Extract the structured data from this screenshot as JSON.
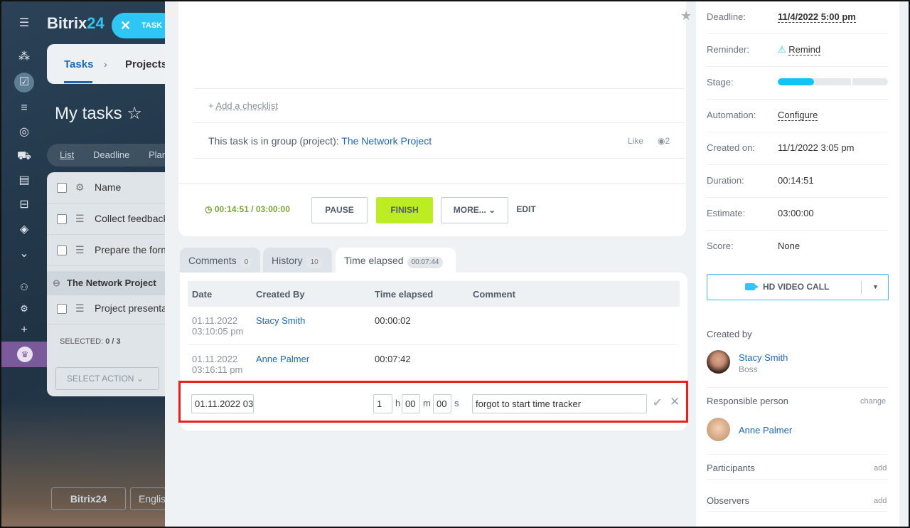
{
  "background": {
    "logo_main": "Bitrix",
    "logo_num": "24",
    "task_button": "TASK",
    "breadcrumb": {
      "tasks": "Tasks",
      "sep": "›",
      "projects": "Projects"
    },
    "page_title": "My tasks ☆",
    "view_tabs": [
      "List",
      "Deadline",
      "Plan"
    ],
    "list_header": "Name",
    "rows": [
      "Collect feedback",
      "Prepare the form"
    ],
    "group_name": "The Network Project",
    "group_row": "Project presenta",
    "selected": "SELECTED:",
    "selected_count": "0 / 3",
    "select_action": "SELECT ACTION",
    "footer_logo": "Bitrix24",
    "footer_lang": "English"
  },
  "task": {
    "add_checklist": "Add a checklist",
    "add_checklist_prefix": "+",
    "group_label": "This task is in group (project):",
    "group_link": "The Network Project",
    "like": "Like",
    "views": "2",
    "timer": "00:14:51 / 03:00:00",
    "buttons": {
      "pause": "PAUSE",
      "finish": "FINISH",
      "more": "MORE...",
      "edit": "EDIT"
    }
  },
  "tabs": [
    {
      "label": "Comments",
      "count": "0"
    },
    {
      "label": "History",
      "count": "10"
    },
    {
      "label": "Time elapsed",
      "count": "00:07:44"
    }
  ],
  "time_table": {
    "headers": [
      "Date",
      "Created By",
      "Time elapsed",
      "Comment"
    ],
    "rows": [
      {
        "date": "01.11.2022",
        "time": "03:10:05 pm",
        "user": "Stacy Smith",
        "elapsed": "00:00:02"
      },
      {
        "date": "01.11.2022",
        "time": "03:16:11 pm",
        "user": "Anne Palmer",
        "elapsed": "00:07:42"
      }
    ],
    "edit": {
      "date": "01.11.2022 03",
      "hours": "1",
      "h": "h",
      "minutes": "00",
      "m": "m",
      "seconds": "00",
      "s": "s",
      "comment": "forgot to start time tracker"
    }
  },
  "sidebar": {
    "deadline": {
      "label": "Deadline:",
      "value": "11/4/2022 5:00 pm"
    },
    "reminder": {
      "label": "Reminder:",
      "value": "Remind"
    },
    "stage": {
      "label": "Stage:",
      "progress": 0.33
    },
    "automation": {
      "label": "Automation:",
      "value": "Configure"
    },
    "created_on": {
      "label": "Created on:",
      "value": "11/1/2022 3:05 pm"
    },
    "duration": {
      "label": "Duration:",
      "value": "00:14:51"
    },
    "estimate": {
      "label": "Estimate:",
      "value": "03:00:00"
    },
    "score": {
      "label": "Score:",
      "value": "None"
    },
    "video_call": "HD VIDEO CALL",
    "created_by": {
      "label": "Created by",
      "name": "Stacy Smith",
      "role": "Boss"
    },
    "responsible": {
      "label": "Responsible person",
      "action": "change",
      "name": "Anne Palmer"
    },
    "participants": {
      "label": "Participants",
      "action": "add"
    },
    "observers": {
      "label": "Observers",
      "action": "add"
    }
  },
  "colors": {
    "accent": "#2fc6f6",
    "finish": "#bbed21",
    "link": "#2067b0",
    "highlight": "#e8201e"
  }
}
